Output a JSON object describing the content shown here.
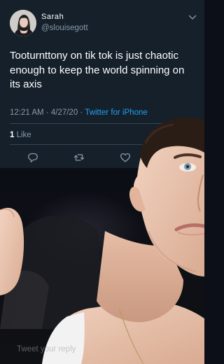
{
  "tweet": {
    "author": {
      "display_name": "Sarah",
      "handle": "@slouisegott",
      "avatar_icon": "profile-photo"
    },
    "text": "Tooturnttony on tik tok is just chaotic enough to keep the world spinning on its axis",
    "time": "12:21 AM",
    "separator": "·",
    "date": "4/27/20",
    "source": "Twitter for iPhone",
    "likes": {
      "count": "1",
      "label": "Like"
    },
    "actions": [
      "reply-icon",
      "retweet-icon",
      "like-icon"
    ]
  },
  "reply_box": {
    "placeholder": "Tweet your reply"
  },
  "colors": {
    "card_background": "#15202b",
    "secondary_text": "#8899a6",
    "link": "#1da1f2",
    "divider": "#38444d"
  }
}
